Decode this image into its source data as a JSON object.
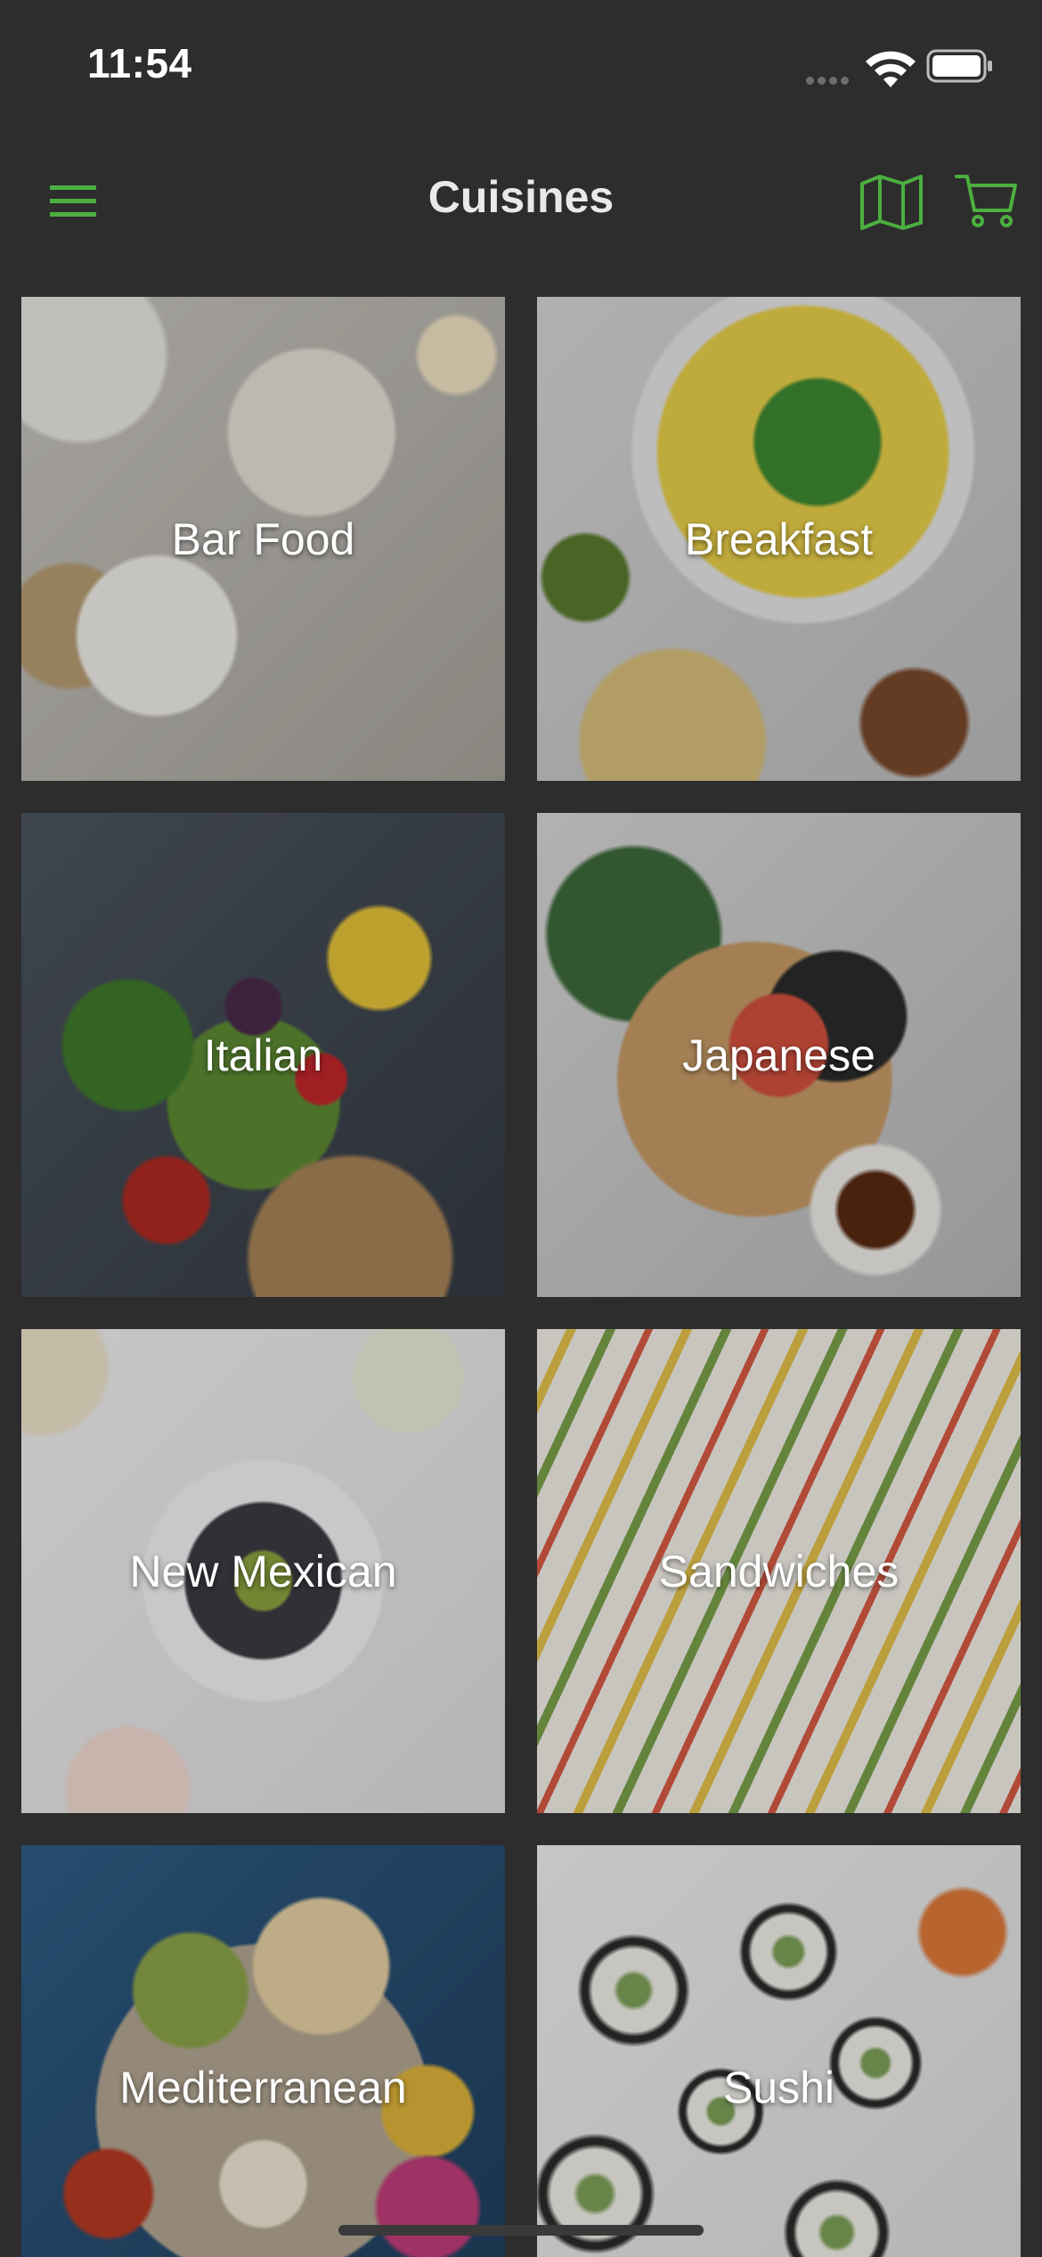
{
  "status_bar": {
    "time": "11:54"
  },
  "nav": {
    "title": "Cuisines",
    "menu_icon": "hamburger-menu-icon",
    "map_icon": "map-icon",
    "cart_icon": "cart-icon"
  },
  "colors": {
    "accent": "#4caf3f",
    "background": "#2d2d2d",
    "title": "#e9e9e9"
  },
  "cuisines": [
    {
      "label": "Bar Food"
    },
    {
      "label": "Breakfast"
    },
    {
      "label": "Italian"
    },
    {
      "label": "Japanese"
    },
    {
      "label": "New Mexican"
    },
    {
      "label": "Sandwiches"
    },
    {
      "label": "Mediterranean"
    },
    {
      "label": "Sushi"
    }
  ]
}
